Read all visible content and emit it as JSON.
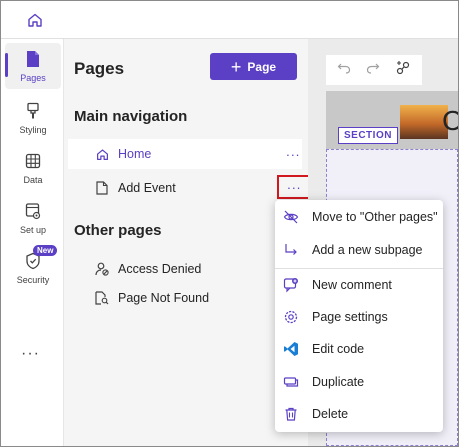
{
  "rail": {
    "items": [
      {
        "label": "Pages"
      },
      {
        "label": "Styling"
      },
      {
        "label": "Data"
      },
      {
        "label": "Set up"
      },
      {
        "label": "Security"
      }
    ],
    "new_badge": "New",
    "more": "···"
  },
  "pages_panel": {
    "title": "Pages",
    "add_button": "Page",
    "main_nav_heading": "Main navigation",
    "main_pages": [
      {
        "label": "Home"
      },
      {
        "label": "Add Event"
      }
    ],
    "other_heading": "Other pages",
    "other_pages": [
      {
        "label": "Access Denied"
      },
      {
        "label": "Page Not Found"
      }
    ],
    "row_more": "···"
  },
  "canvas": {
    "hero_letter": "C",
    "section_label": "SECTION"
  },
  "context_menu": {
    "items": [
      {
        "label": "Move to \"Other pages\"",
        "icon": "move-eye-icon"
      },
      {
        "label": "Add a new subpage",
        "icon": "subpage-arrow-icon"
      },
      {
        "label": "New comment",
        "icon": "comment-icon"
      },
      {
        "label": "Page settings",
        "icon": "settings-gear-icon"
      },
      {
        "label": "Edit code",
        "icon": "vscode-icon"
      },
      {
        "label": "Duplicate",
        "icon": "duplicate-icon"
      },
      {
        "label": "Delete",
        "icon": "trash-icon"
      }
    ]
  },
  "colors": {
    "accent": "#5b3fc4",
    "highlight_border": "#d1181f",
    "vscode_blue": "#1a7fd4"
  }
}
